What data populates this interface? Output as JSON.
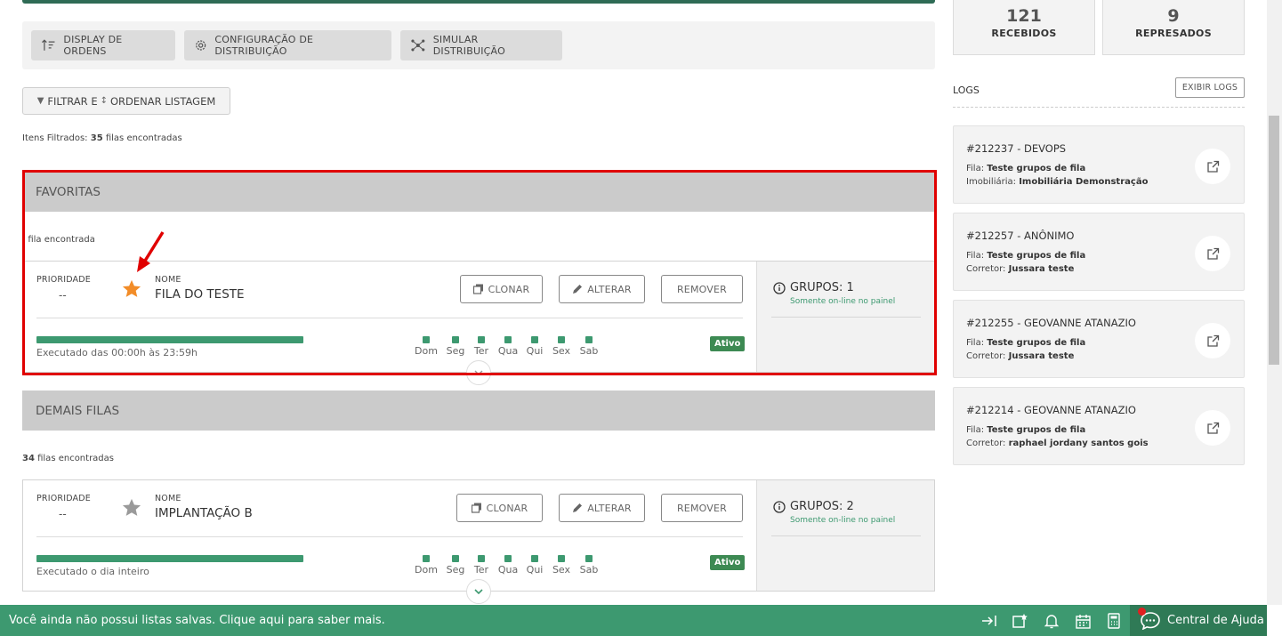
{
  "toolbar": {
    "display_label": "DISPLAY DE ORDENS",
    "config_label": "CONFIGURAÇÃO DE DISTRIBUIÇÃO",
    "simular_label": "SIMULAR DISTRIBUIÇÃO"
  },
  "filter": {
    "label_prefix": "FILTRAR E",
    "label_suffix": "ORDENAR LISTAGEM",
    "filtered_prefix": "Itens Filtrados:",
    "filtered_count": "35",
    "filtered_suffix": "filas encontradas"
  },
  "favoritas": {
    "title": "FAVORITAS",
    "count_text": ". fila encontrada",
    "card": {
      "priority_label": "PRIORIDADE",
      "priority_value": "--",
      "name_label": "NOME",
      "name_value": "FILA DO TESTE",
      "clone_label": "CLONAR",
      "alter_label": "ALTERAR",
      "remove_label": "REMOVER",
      "exec_text": "Executado das 00:00h às 23:59h",
      "status": "Ativo",
      "groups_label": "GRUPOS: 1",
      "online_text": "Somente on-line no painel",
      "starred": true
    }
  },
  "demais": {
    "title": "DEMAIS FILAS",
    "count_number": "34",
    "count_suffix": "filas encontradas",
    "card": {
      "priority_label": "PRIORIDADE",
      "priority_value": "--",
      "name_label": "NOME",
      "name_value": "IMPLANTAÇÃO B",
      "clone_label": "CLONAR",
      "alter_label": "ALTERAR",
      "remove_label": "REMOVER",
      "exec_text": "Executado o dia inteiro",
      "status": "Ativo",
      "groups_label": "GRUPOS: 2",
      "online_text": "Somente on-line no painel",
      "starred": false
    }
  },
  "days": [
    "Dom",
    "Seg",
    "Ter",
    "Qua",
    "Qui",
    "Sex",
    "Sab"
  ],
  "stats": {
    "received_value": "121",
    "received_label": "RECEBIDOS",
    "held_value": "9",
    "held_label": "REPRESADOS"
  },
  "logs": {
    "title": "LOGS",
    "show_button": "EXIBIR LOGS",
    "items": [
      {
        "title": "#212237 - DEVOPS",
        "k1": "Fila:",
        "v1": "Teste grupos de fila",
        "k2": "Imobiliária:",
        "v2": "Imobiliária Demonstração"
      },
      {
        "title": "#212257 - ANÔNIMO",
        "k1": "Fila:",
        "v1": "Teste grupos de fila",
        "k2": "Corretor:",
        "v2": "Jussara teste"
      },
      {
        "title": "#212255 - GEOVANNE ATANAZIO",
        "k1": "Fila:",
        "v1": "Teste grupos de fila",
        "k2": "Corretor:",
        "v2": "Jussara teste"
      },
      {
        "title": "#212214 - GEOVANNE ATANAZIO",
        "k1": "Fila:",
        "v1": "Teste grupos de fila",
        "k2": "Corretor:",
        "v2": "raphael jordany santos gois"
      }
    ]
  },
  "bottom": {
    "message": "Você ainda não possui listas salvas. Clique aqui para saber mais.",
    "help_label": "Central de Ajuda"
  },
  "colors": {
    "accent": "#3d9970",
    "highlight_border": "#e00000",
    "star_active": "#f28c28",
    "star_inactive": "#9a9a9a"
  }
}
